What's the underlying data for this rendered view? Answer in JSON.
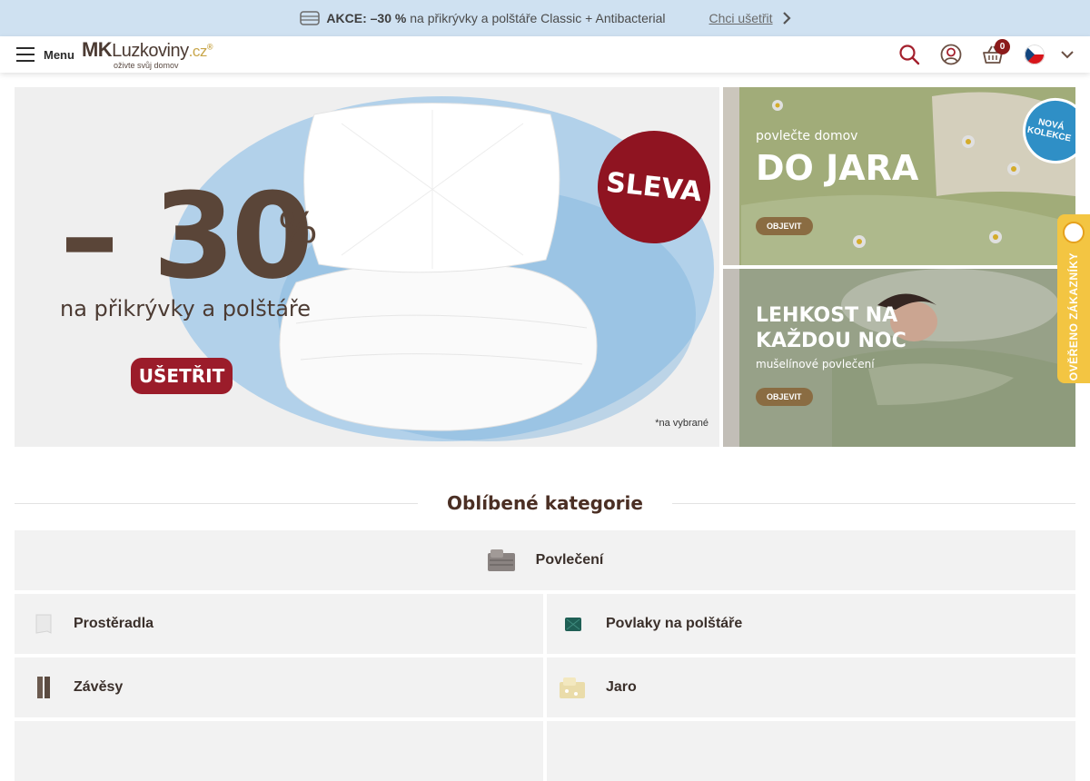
{
  "promo": {
    "prefix": "AKCE: –30 %",
    "text": " na přikrývky a polštáře Classic + Antibacterial",
    "cta": "Chci ušetřit",
    "icon": "blanket-icon"
  },
  "header": {
    "menu_label": "Menu",
    "logo_mk": "MK",
    "logo_name": "Luzkoviny",
    "logo_tld": ".cz",
    "logo_reg": "®",
    "logo_tagline": "oživte svůj domov",
    "cart_count": "0",
    "language": "cs",
    "icons": [
      "search-icon",
      "account-icon",
      "cart-icon",
      "czech-flag-icon",
      "chevron-down-icon"
    ]
  },
  "hero": {
    "main": {
      "amount": "– 30",
      "percent": "%",
      "subtitle": "na přikrývky a polštáře",
      "cta": "UŠETŘIT",
      "badge": "SLEVA",
      "note": "*na vybrané"
    },
    "side1": {
      "kicker": "povlečte domov",
      "headline": "DO JARA",
      "cta": "OBJEVIT",
      "badge_line1": "NOVÁ",
      "badge_line2": "KOLEKCE"
    },
    "side2": {
      "headline_line1": "LEHKOST NA",
      "headline_line2": "KAŽDOU NOC",
      "kicker": "mušelínové povlečení",
      "cta": "OBJEVIT"
    }
  },
  "verified_badge": "OVĚŘENO ZÁKAZNÍKY",
  "categories": {
    "title": "Oblíbené kategorie",
    "items": [
      {
        "label": "Povlečení",
        "color": "#7d7775"
      },
      {
        "label": "Prostěradla",
        "color": "#e6e6e6"
      },
      {
        "label": "Povlaky na polštáře",
        "color": "#1f5f55"
      },
      {
        "label": "Závěsy",
        "color": "#6b5a4f"
      },
      {
        "label": "Jaro",
        "color": "#e8d9a6"
      }
    ]
  },
  "colors": {
    "promo_bg": "#cfe1f1",
    "brand_red": "#9b1c2a",
    "brand_brown": "#4b2f24",
    "accent_gold": "#c8a64a",
    "verified_yellow": "#f3c542"
  }
}
